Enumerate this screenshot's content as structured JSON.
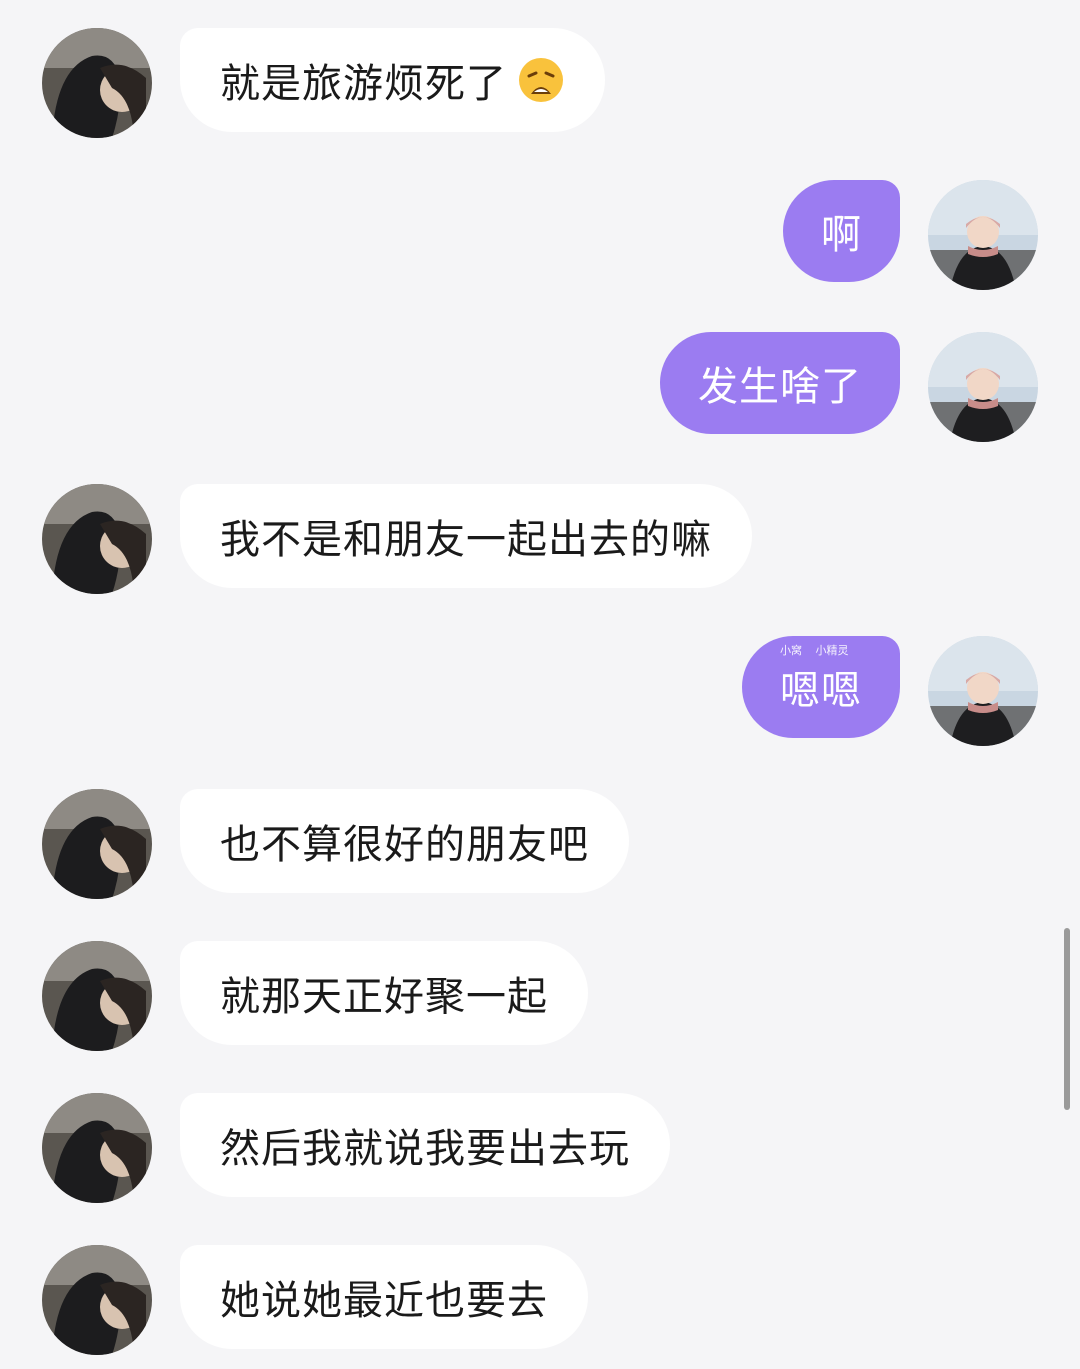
{
  "messages": [
    {
      "side": "in",
      "text": "就是旅游烦死了",
      "emoji": "weary-face-emoji"
    },
    {
      "side": "out",
      "text": "啊"
    },
    {
      "side": "out",
      "text": "发生啥了"
    },
    {
      "side": "in",
      "text": "我不是和朋友一起出去的嘛"
    },
    {
      "side": "out",
      "text": "嗯嗯",
      "sticker_tags": [
        "小窝",
        "小精灵"
      ]
    },
    {
      "side": "in",
      "text": "也不算很好的朋友吧"
    },
    {
      "side": "in",
      "text": "就那天正好聚一起"
    },
    {
      "side": "in",
      "text": "然后我就说我要出去玩"
    },
    {
      "side": "in",
      "text": "她说她最近也要去"
    }
  ],
  "avatars": {
    "left": "cat-avatar",
    "right": "profile-photo-avatar"
  },
  "colors": {
    "background": "#f5f5f7",
    "incoming_bubble": "#ffffff",
    "outgoing_bubble": "#9b7cf1"
  }
}
